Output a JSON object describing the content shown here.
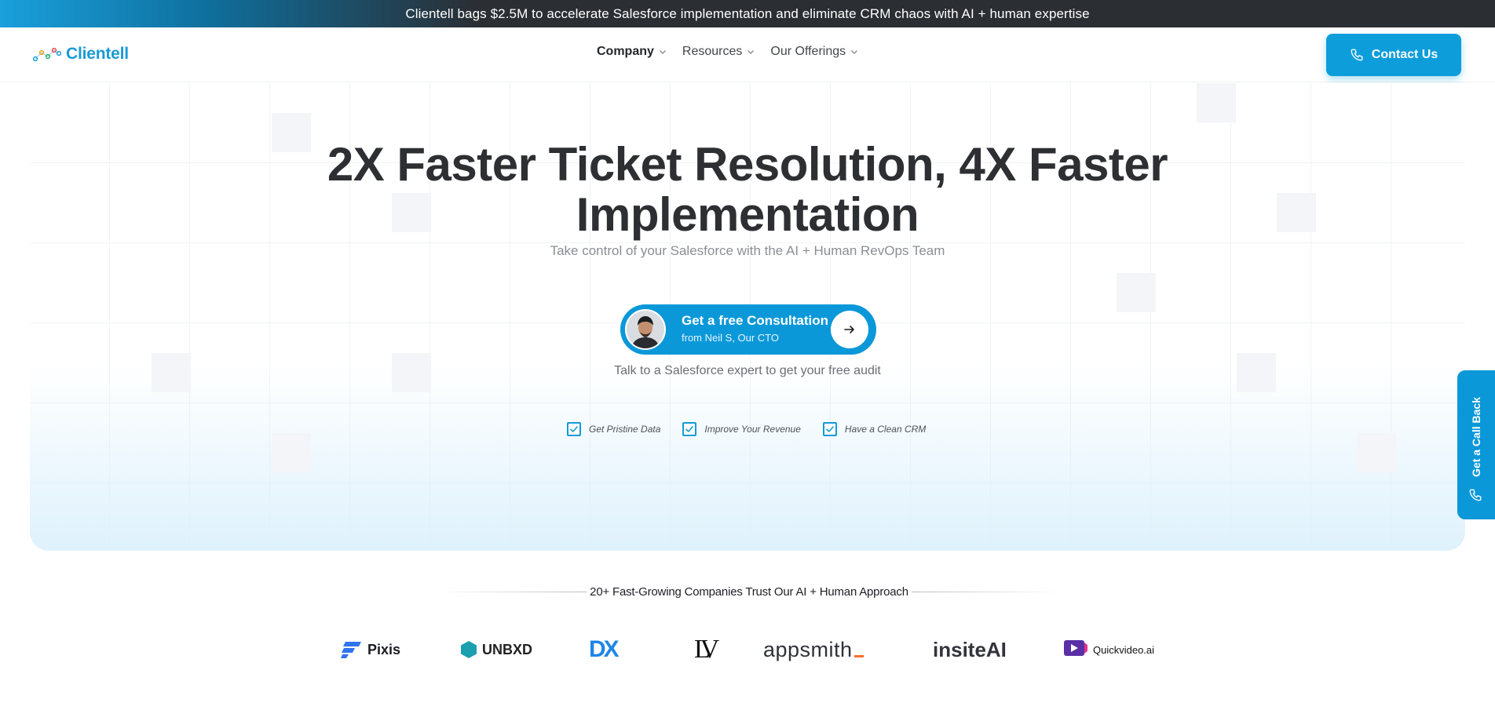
{
  "announcement": {
    "text": "Clientell bags $2.5M to accelerate Salesforce implementation and eliminate CRM chaos with AI + human expertise"
  },
  "header": {
    "logo_text": "Clientell",
    "nav": [
      {
        "label": "Company"
      },
      {
        "label": "Resources"
      },
      {
        "label": "Our Offerings"
      }
    ],
    "contact_label": "Contact Us"
  },
  "hero": {
    "title_line1": "2X Faster Ticket Resolution, 4X Faster",
    "title_line2": "Implementation",
    "subtitle": "Take control of your Salesforce with the AI + Human RevOps Team",
    "cta": {
      "title": "Get a free Consultation",
      "subtitle": "from Neil S, Our CTO"
    },
    "cta_note": "Talk to a Salesforce expert to get your free audit",
    "checks": [
      {
        "label": "Get Pristine Data"
      },
      {
        "label": "Improve Your Revenue"
      },
      {
        "label": "Have a Clean CRM"
      }
    ]
  },
  "side_tab": {
    "label": "Get a Call Back"
  },
  "trust": {
    "heading": "20+ Fast-Growing Companies Trust Our AI + Human Approach",
    "logos": [
      "Pixis",
      "UNBXD",
      "DX",
      "LV",
      "appsmith",
      "insiteAI",
      "Quickvideo.ai"
    ]
  },
  "colors": {
    "brand_blue": "#0b98d8",
    "heading_dark": "#2e2f33",
    "announcement_dark": "#2b2e33"
  }
}
